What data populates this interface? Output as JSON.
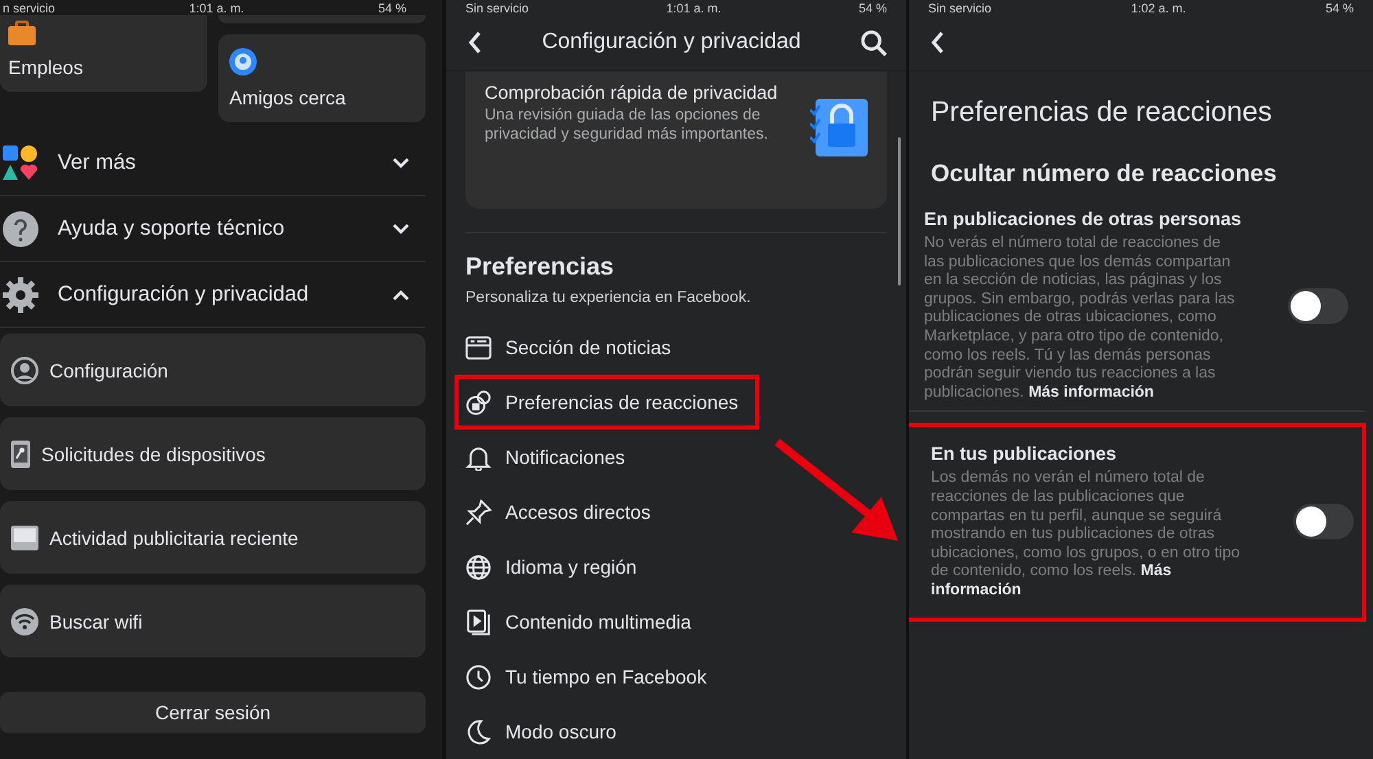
{
  "menu_screen": {
    "status_bar": {
      "carrier": "n servicio",
      "time": "1:01 a. m.",
      "battery": "54 %"
    },
    "shortcuts": [
      {
        "label": "Empleos",
        "kind": "jobs"
      },
      {
        "label": "Amigos cerca",
        "kind": "nearby"
      }
    ],
    "sections": [
      {
        "label": "Ver más",
        "kind": "more",
        "expanded": false
      },
      {
        "label": "Ayuda y soporte técnico",
        "kind": "help",
        "expanded": false
      },
      {
        "label": "Configuración y privacidad",
        "kind": "settings",
        "expanded": true
      }
    ],
    "settings_items": [
      {
        "label": "Configuración",
        "kind": "profile"
      },
      {
        "label": "Solicitudes de dispositivos",
        "kind": "device"
      },
      {
        "label": "Actividad publicitaria reciente",
        "kind": "ads"
      },
      {
        "label": "Buscar wifi",
        "kind": "wifi"
      }
    ],
    "logout_button": "Cerrar sesión"
  },
  "settings_screen": {
    "status_bar": {
      "carrier": "Sin servicio",
      "time": "1:01 a. m.",
      "battery": "54 %"
    },
    "title": "Configuración y privacidad",
    "privacy_card": {
      "title": "Comprobación rápida de privacidad",
      "description": "Una revisión guiada de las opciones de privacidad y seguridad más importantes."
    },
    "preferences": {
      "title": "Preferencias",
      "subtitle": "Personaliza tu experiencia en Facebook.",
      "items": [
        {
          "label": "Sección de noticias",
          "kind": "feed",
          "highlighted": false
        },
        {
          "label": "Preferencias de reacciones",
          "kind": "reactions",
          "highlighted": true
        },
        {
          "label": "Notificaciones",
          "kind": "bell",
          "highlighted": false
        },
        {
          "label": "Accesos directos",
          "kind": "pin",
          "highlighted": false
        },
        {
          "label": "Idioma y región",
          "kind": "globe",
          "highlighted": false
        },
        {
          "label": "Contenido multimedia",
          "kind": "media",
          "highlighted": false
        },
        {
          "label": "Tu tiempo en Facebook",
          "kind": "clock",
          "highlighted": false
        },
        {
          "label": "Modo oscuro",
          "kind": "moon",
          "highlighted": false
        }
      ]
    }
  },
  "reactions_screen": {
    "status_bar": {
      "carrier": "Sin servicio",
      "time": "1:02 a. m.",
      "battery": "54 %"
    },
    "title": "Preferencias de reacciones",
    "section_title": "Ocultar número de reacciones",
    "options": [
      {
        "title": "En publicaciones de otras personas",
        "description": "No verás el número total de reacciones de las publicaciones que los demás compartan en la sección de noticias, las páginas y los grupos. Sin embargo, podrás verlas para las publicaciones de otras ubicaciones, como Marketplace, y para otro tipo de contenido, como los reels. Tú y las demás personas podrán seguir viendo tus reacciones a las publicaciones. **Más información**",
        "on": false,
        "highlighted": false
      },
      {
        "title": "En tus publicaciones",
        "description": "Los demás no verán el número total de reacciones de las publicaciones que compartas en tu perfil, aunque se seguirá mostrando en tus publicaciones de otras ubicaciones, como los grupos, o en otro tipo de contenido, como los reels. **Más información**",
        "on": false,
        "highlighted": true
      }
    ]
  }
}
